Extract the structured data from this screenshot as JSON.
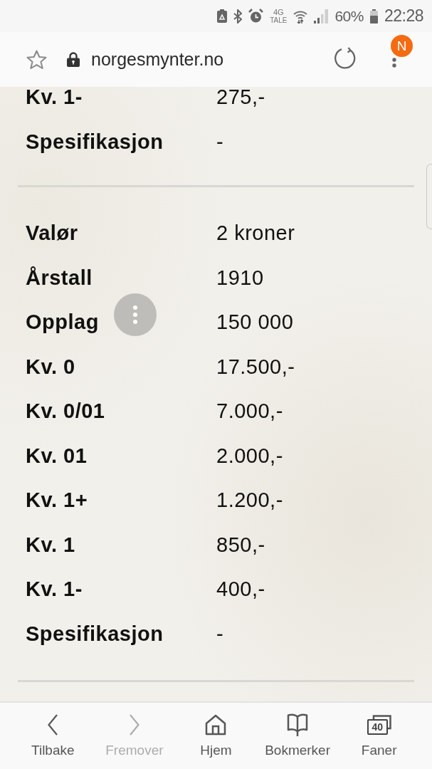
{
  "status_bar": {
    "network": "4G",
    "network_sub": "TALE",
    "battery": "60%",
    "time": "22:28"
  },
  "address_bar": {
    "url": "norgesmynter.no",
    "notification_badge": "N"
  },
  "coin_entries": [
    {
      "rows": [
        {
          "label": "Kv. 1-",
          "value": "275,-"
        },
        {
          "label": "Spesifikasjon",
          "value": "-"
        }
      ]
    },
    {
      "rows": [
        {
          "label": "Valør",
          "value": "2 kroner"
        },
        {
          "label": "Årstall",
          "value": "1910"
        },
        {
          "label": "Opplag",
          "value": "150 000"
        },
        {
          "label": "Kv. 0",
          "value": "17.500,-"
        },
        {
          "label": "Kv. 0/01",
          "value": "7.000,-"
        },
        {
          "label": "Kv. 01",
          "value": "2.000,-"
        },
        {
          "label": "Kv. 1+",
          "value": "1.200,-"
        },
        {
          "label": "Kv. 1",
          "value": "850,-"
        },
        {
          "label": "Kv. 1-",
          "value": "400,-"
        },
        {
          "label": "Spesifikasjon",
          "value": "-"
        }
      ]
    }
  ],
  "bottom_nav": [
    {
      "kind": "back",
      "label": "Tilbake",
      "disabled": false
    },
    {
      "kind": "forward",
      "label": "Fremover",
      "disabled": true
    },
    {
      "kind": "home",
      "label": "Hjem",
      "disabled": false
    },
    {
      "kind": "bookmarks",
      "label": "Bokmerker",
      "disabled": false
    },
    {
      "kind": "tabs",
      "label": "Faner",
      "disabled": false,
      "count": "40"
    }
  ]
}
